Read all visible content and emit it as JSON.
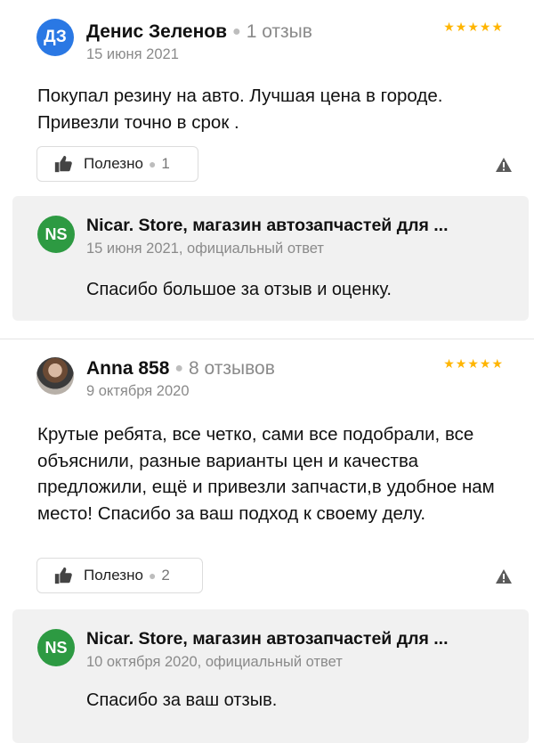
{
  "reviews": [
    {
      "initials": "ДЗ",
      "name": "Денис Зеленов",
      "reviews_count": "1 отзыв",
      "date": "15 июня 2021",
      "stars": 5,
      "text": "Покупал резину на авто. Лучшая цена в городе. Привезли точно в срок .",
      "useful_label": "Полезно",
      "useful_count": "1",
      "reply": {
        "initials": "NS",
        "org": "Nicar. Store, магазин автозапчастей для ...",
        "date": "15 июня 2021, официальный ответ",
        "text": "Спасибо большое за отзыв и оценку."
      }
    },
    {
      "initials": "",
      "name": "Anna 858",
      "reviews_count": "8 отзывов",
      "date": "9 октября 2020",
      "stars": 5,
      "text": "Крутые ребята, все четко, сами все подобрали, все объяснили, разные варианты цен и качества предложили, ещё и привезли запчасти,в удобное нам место! Спасибо за ваш подход к своему делу.",
      "useful_label": "Полезно",
      "useful_count": "2",
      "reply": {
        "initials": "NS",
        "org": "Nicar. Store, магазин автозапчастей для ...",
        "date": "10 октября 2020, официальный ответ",
        "text": "Спасибо за ваш отзыв."
      }
    }
  ],
  "colors": {
    "star": "#ffb500",
    "brand_green": "#2d9a42",
    "avatar_blue": "#2a78e4"
  },
  "icons": [
    "thumbs-up-icon",
    "warning-icon",
    "star-icon"
  ]
}
